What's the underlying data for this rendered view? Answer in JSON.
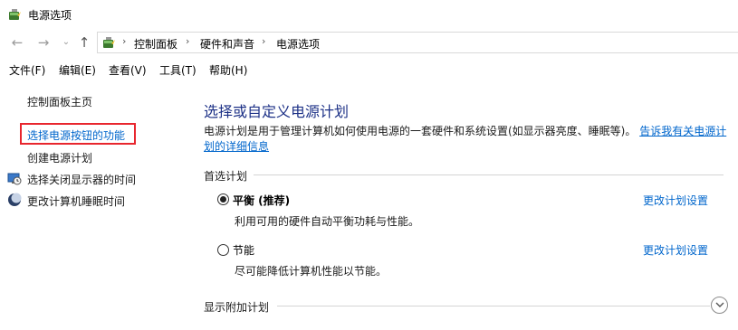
{
  "window": {
    "title": "电源选项",
    "icon": "power-options-icon"
  },
  "nav": {
    "back_icon": "arrow-left-icon",
    "forward_icon": "arrow-right-icon",
    "recent_icon": "chevron-down-icon",
    "up_icon": "arrow-up-icon",
    "breadcrumbs": [
      "控制面板",
      "硬件和声音",
      "电源选项"
    ]
  },
  "menu": {
    "items": [
      "文件(F)",
      "编辑(E)",
      "查看(V)",
      "工具(T)",
      "帮助(H)"
    ]
  },
  "sidebar": {
    "home": "控制面板主页",
    "links": [
      {
        "label": "选择电源按钮的功能",
        "highlighted": true
      },
      {
        "label": "创建电源计划"
      },
      {
        "label": "选择关闭显示器的时间",
        "icon": "monitor-clock-icon"
      },
      {
        "label": "更改计算机睡眠时间",
        "icon": "moon-icon"
      }
    ],
    "highlight_color": "#e8262e"
  },
  "main": {
    "title": "选择或自定义电源计划",
    "description": "电源计划是用于管理计算机如何使用电源的一套硬件和系统设置(如显示器亮度、睡眠等)。",
    "description_link": "告诉我有关电源计划的详细信息",
    "preferred_label": "首选计划",
    "plans": [
      {
        "name": "平衡 (推荐)",
        "desc": "利用可用的硬件自动平衡功耗与性能。",
        "selected": true,
        "change_link": "更改计划设置"
      },
      {
        "name": "节能",
        "desc": "尽可能降低计算机性能以节能。",
        "selected": false,
        "change_link": "更改计划设置"
      }
    ],
    "additional_label": "显示附加计划",
    "expand_icon": "chevron-down-circle-icon"
  },
  "colors": {
    "link": "#0066cc",
    "title": "#1e3287"
  }
}
